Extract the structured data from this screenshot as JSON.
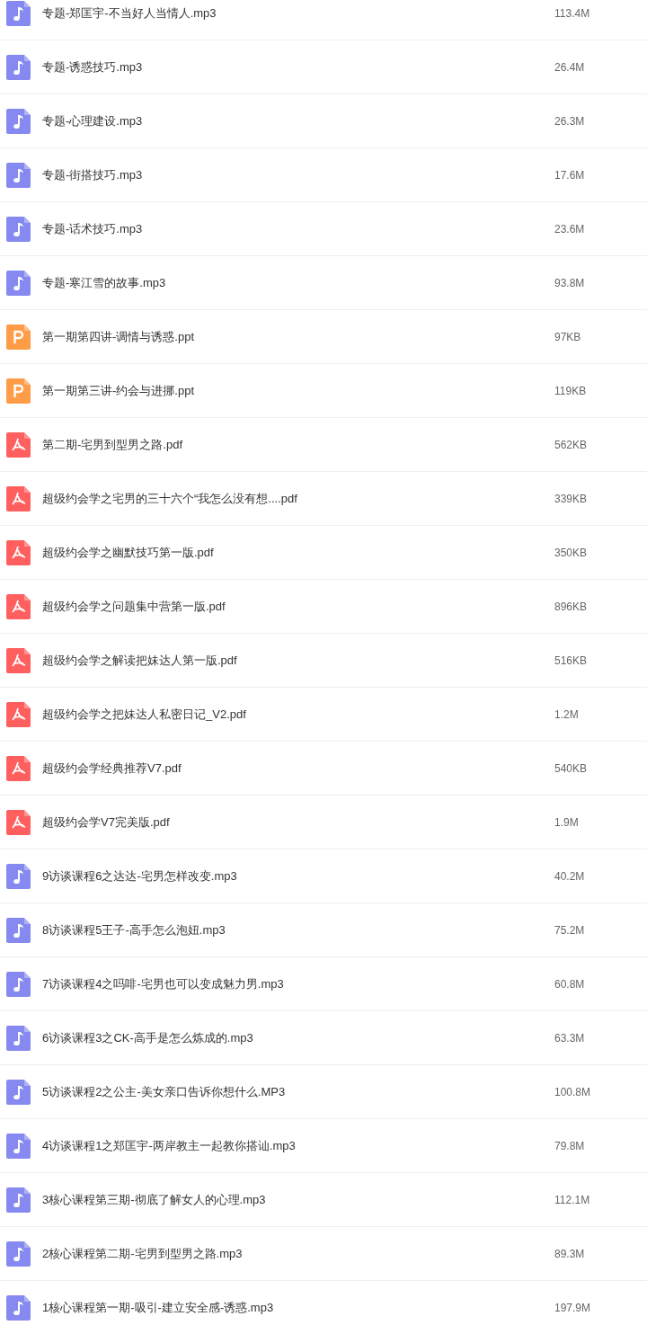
{
  "files": [
    {
      "kind": "audio",
      "name": "专题-郑匡宇-不当好人当情人.mp3",
      "size": "113.4M"
    },
    {
      "kind": "audio",
      "name": "专题-诱惑技巧.mp3",
      "size": "26.4M"
    },
    {
      "kind": "audio",
      "name": "专题-心理建设.mp3",
      "size": "26.3M"
    },
    {
      "kind": "audio",
      "name": "专题-街搭技巧.mp3",
      "size": "17.6M"
    },
    {
      "kind": "audio",
      "name": "专题-话术技巧.mp3",
      "size": "23.6M"
    },
    {
      "kind": "audio",
      "name": "专题-寒江雪的故事.mp3",
      "size": "93.8M"
    },
    {
      "kind": "ppt",
      "name": "第一期第四讲-调情与诱惑.ppt",
      "size": "97KB"
    },
    {
      "kind": "ppt",
      "name": "第一期第三讲-约会与进挪.ppt",
      "size": "119KB"
    },
    {
      "kind": "pdf",
      "name": "第二期-宅男到型男之路.pdf",
      "size": "562KB"
    },
    {
      "kind": "pdf",
      "name": "超级约会学之宅男的三十六个“我怎么没有想....pdf",
      "size": "339KB"
    },
    {
      "kind": "pdf",
      "name": "超级约会学之幽默技巧第一版.pdf",
      "size": "350KB"
    },
    {
      "kind": "pdf",
      "name": "超级约会学之问题集中营第一版.pdf",
      "size": "896KB"
    },
    {
      "kind": "pdf",
      "name": "超级约会学之解读把妹达人第一版.pdf",
      "size": "516KB"
    },
    {
      "kind": "pdf",
      "name": "超级约会学之把妹达人私密日记_V2.pdf",
      "size": "1.2M"
    },
    {
      "kind": "pdf",
      "name": "超级约会学经典推荐V7.pdf",
      "size": "540KB"
    },
    {
      "kind": "pdf",
      "name": "超级约会学V7完美版.pdf",
      "size": "1.9M"
    },
    {
      "kind": "audio",
      "name": "9访谈课程6之达达-宅男怎样改变.mp3",
      "size": "40.2M"
    },
    {
      "kind": "audio",
      "name": "8访谈课程5王子-高手怎么泡妞.mp3",
      "size": "75.2M"
    },
    {
      "kind": "audio",
      "name": "7访谈课程4之吗啡-宅男也可以变成魅力男.mp3",
      "size": "60.8M"
    },
    {
      "kind": "audio",
      "name": "6访谈课程3之CK-高手是怎么炼成的.mp3",
      "size": "63.3M"
    },
    {
      "kind": "audio",
      "name": "5访谈课程2之公主-美女亲口告诉你想什么.MP3",
      "size": "100.8M"
    },
    {
      "kind": "audio",
      "name": "4访谈课程1之郑匡宇-两岸教主一起教你搭讪.mp3",
      "size": "79.8M"
    },
    {
      "kind": "audio",
      "name": "3核心课程第三期-彻底了解女人的心理.mp3",
      "size": "112.1M"
    },
    {
      "kind": "audio",
      "name": "2核心课程第二期-宅男到型男之路.mp3",
      "size": "89.3M"
    },
    {
      "kind": "audio",
      "name": "1核心课程第一期-吸引-建立安全感-诱惑.mp3",
      "size": "197.9M"
    }
  ]
}
